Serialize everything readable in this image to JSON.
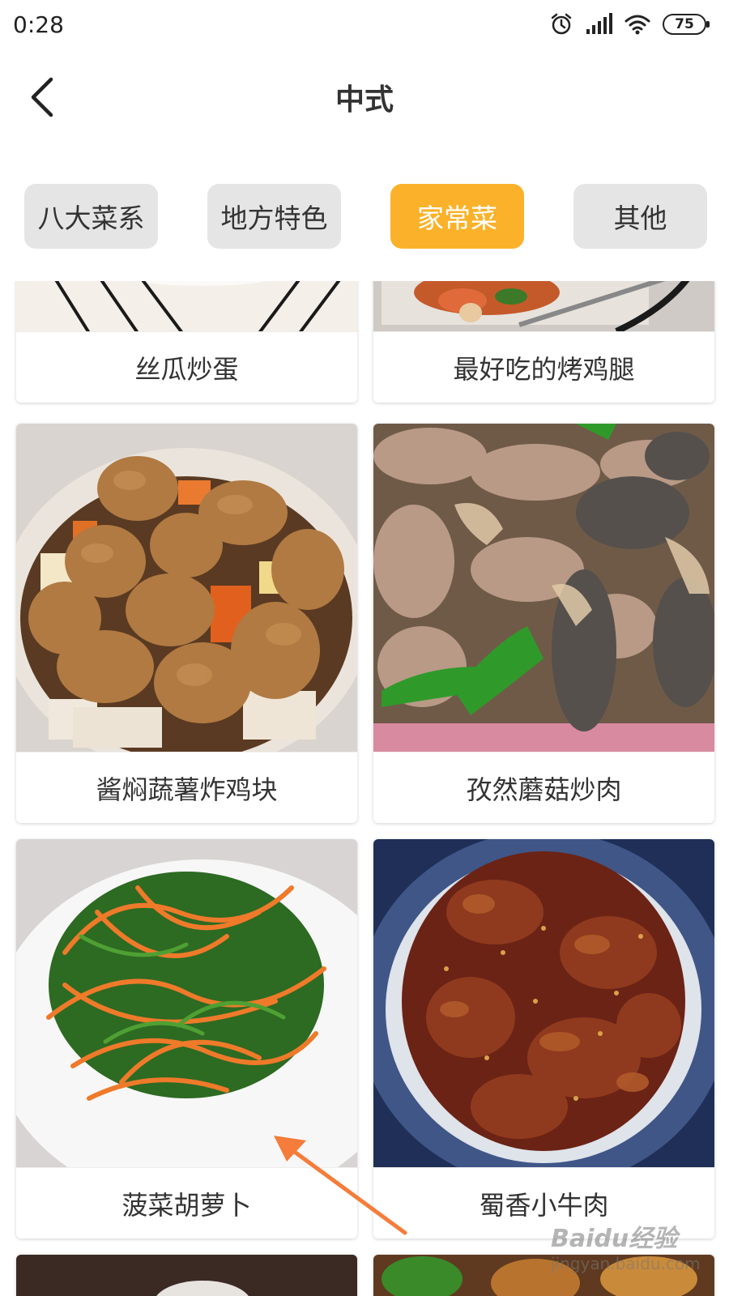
{
  "status": {
    "time": "0:28",
    "battery": "75"
  },
  "header": {
    "title": "中式"
  },
  "tabs": [
    {
      "label": "八大菜系",
      "active": false
    },
    {
      "label": "地方特色",
      "active": false
    },
    {
      "label": "家常菜",
      "active": true
    },
    {
      "label": "其他",
      "active": false
    }
  ],
  "dishes": [
    {
      "name": "丝瓜炒蛋"
    },
    {
      "name": "最好吃的烤鸡腿"
    },
    {
      "name": "酱焖蔬薯炸鸡块"
    },
    {
      "name": "孜然蘑菇炒肉"
    },
    {
      "name": "菠菜胡萝卜"
    },
    {
      "name": "蜀香小牛肉"
    }
  ],
  "watermark": {
    "logo": "Baidu经验",
    "url": "jingyan.baidu.com"
  },
  "colors": {
    "accent": "#fbb22a",
    "tab_inactive": "#e5e5e5",
    "annotation_arrow": "#f57c3a"
  },
  "icons": [
    "back-arrow-icon",
    "alarm-icon",
    "signal-icon",
    "wifi-icon",
    "battery-icon"
  ]
}
